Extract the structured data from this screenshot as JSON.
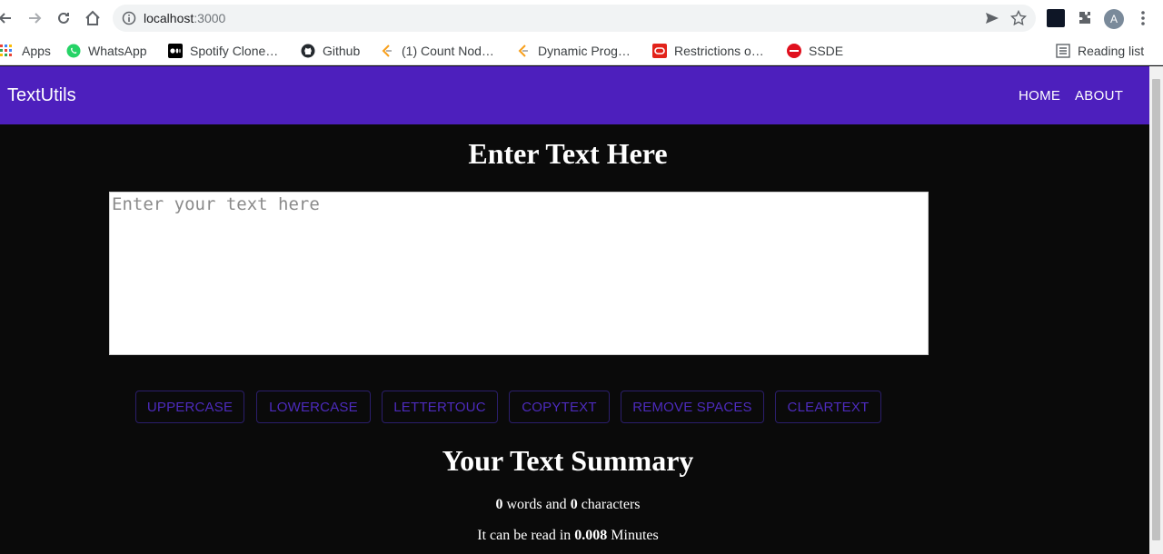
{
  "browser": {
    "url_host": "localhost",
    "url_port": ":3000",
    "avatar_letter": "A",
    "bookmarks": [
      {
        "label": "Apps",
        "icon": "apps-grid-icon"
      },
      {
        "label": "WhatsApp",
        "icon": "whatsapp-icon"
      },
      {
        "label": "Spotify Clone…",
        "icon": "medium-icon"
      },
      {
        "label": "Github",
        "icon": "github-icon"
      },
      {
        "label": "(1) Count Nod…",
        "icon": "leetcode-icon"
      },
      {
        "label": "Dynamic Prog…",
        "icon": "leetcode-icon"
      },
      {
        "label": "Restrictions o…",
        "icon": "oracle-icon"
      },
      {
        "label": "SSDE",
        "icon": "tuf-icon"
      }
    ],
    "reading_list": "Reading list"
  },
  "navbar": {
    "brand": "TextUtils",
    "links": [
      "HOME",
      "ABOUT"
    ],
    "color": "#4d1fbd"
  },
  "main": {
    "heading": "Enter Text Here",
    "textarea_placeholder": "Enter your text here",
    "buttons": [
      "UPPERCASE",
      "LOWERCASE",
      "LETTERTOUC",
      "COPYTEXT",
      "REMOVE SPACES",
      "CLEARTEXT"
    ]
  },
  "summary": {
    "title": "Your Text Summary",
    "words": "0",
    "words_label": " words and ",
    "characters": "0",
    "characters_label": " characters",
    "read_prefix": "It can be read in ",
    "minutes": "0.008",
    "minutes_label": " Minutes"
  }
}
